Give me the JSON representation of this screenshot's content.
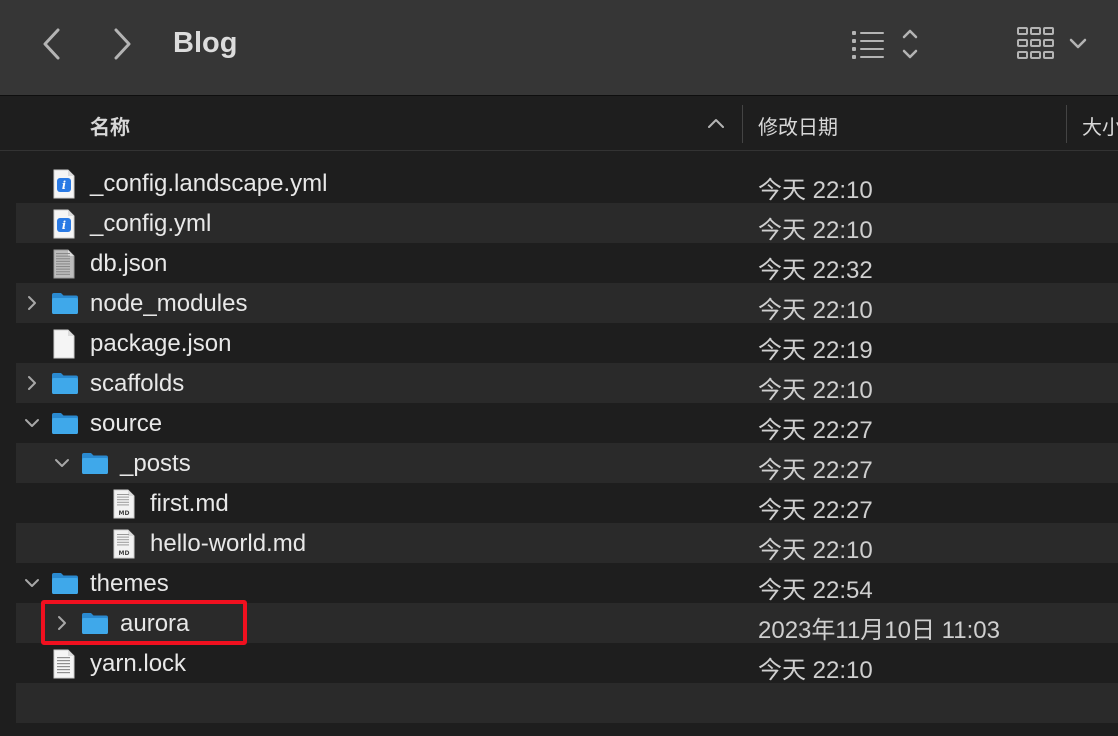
{
  "window": {
    "title": "Blog",
    "back_icon": "chevron-left-icon",
    "forward_icon": "chevron-right-icon",
    "view_icon": "list-view-icon",
    "group_icon": "icon-grid-icon"
  },
  "columns": {
    "name": "名称",
    "date": "修改日期",
    "size": "大小"
  },
  "files": [
    {
      "name": "_config.landscape.yml",
      "date": "今天 22:10",
      "icon": "yaml-file-icon",
      "depth": 0,
      "disclosure": "none"
    },
    {
      "name": "_config.yml",
      "date": "今天 22:10",
      "icon": "yaml-file-icon",
      "depth": 0,
      "disclosure": "none"
    },
    {
      "name": "db.json",
      "date": "今天 22:32",
      "icon": "json-file-icon",
      "depth": 0,
      "disclosure": "none"
    },
    {
      "name": "node_modules",
      "date": "今天 22:10",
      "icon": "folder-icon",
      "depth": 0,
      "disclosure": "collapsed"
    },
    {
      "name": "package.json",
      "date": "今天 22:19",
      "icon": "document-icon",
      "depth": 0,
      "disclosure": "none"
    },
    {
      "name": "scaffolds",
      "date": "今天 22:10",
      "icon": "folder-icon",
      "depth": 0,
      "disclosure": "collapsed"
    },
    {
      "name": "source",
      "date": "今天 22:27",
      "icon": "folder-icon",
      "depth": 0,
      "disclosure": "expanded"
    },
    {
      "name": "_posts",
      "date": "今天 22:27",
      "icon": "folder-icon",
      "depth": 1,
      "disclosure": "expanded"
    },
    {
      "name": "first.md",
      "date": "今天 22:27",
      "icon": "markdown-file-icon",
      "depth": 2,
      "disclosure": "none"
    },
    {
      "name": "hello-world.md",
      "date": "今天 22:10",
      "icon": "markdown-file-icon",
      "depth": 2,
      "disclosure": "none"
    },
    {
      "name": "themes",
      "date": "今天 22:54",
      "icon": "folder-icon",
      "depth": 0,
      "disclosure": "expanded"
    },
    {
      "name": "aurora",
      "date": "2023年11月10日 11:03",
      "icon": "folder-icon",
      "depth": 1,
      "disclosure": "collapsed"
    },
    {
      "name": "yarn.lock",
      "date": "今天 22:10",
      "icon": "text-file-icon",
      "depth": 0,
      "disclosure": "none"
    }
  ],
  "colors": {
    "folder": "#3fa8ea",
    "highlight": "#f0101f",
    "yaml_badge": "#2a7ae4"
  }
}
